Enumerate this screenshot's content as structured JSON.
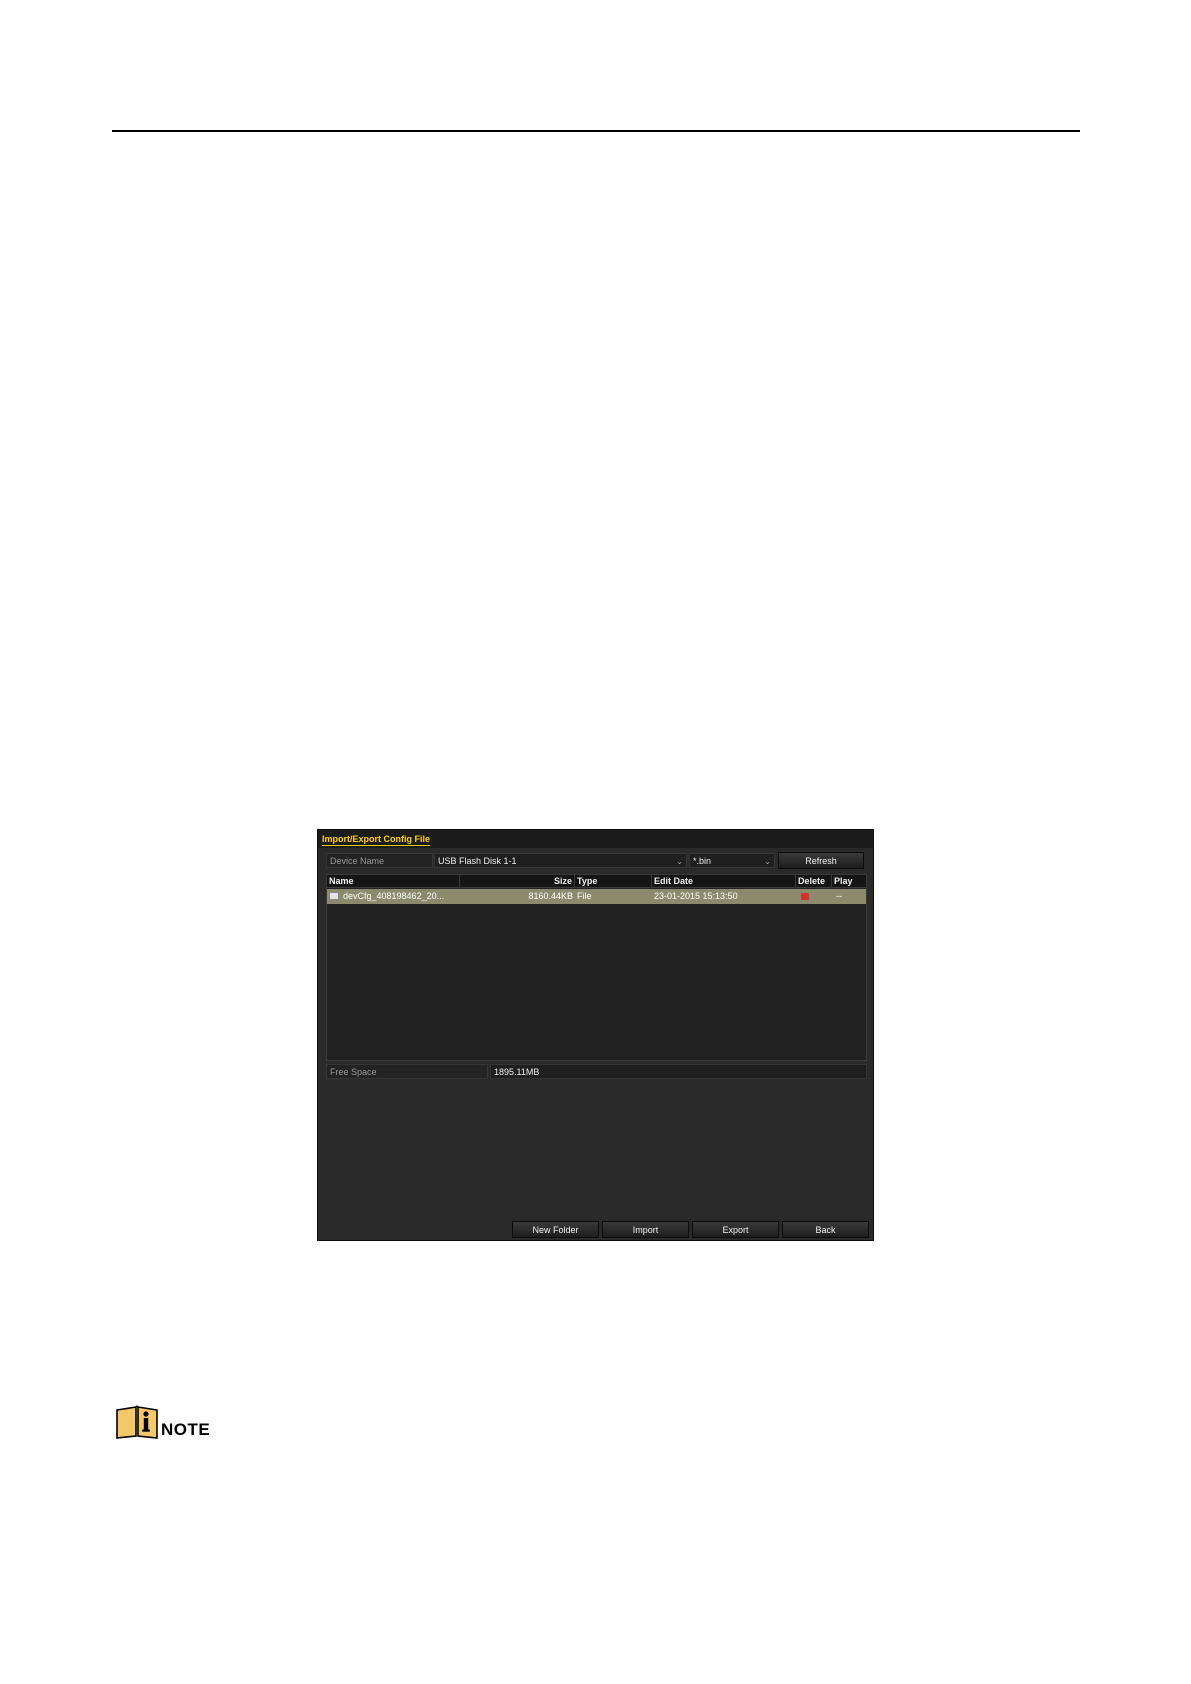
{
  "dialog": {
    "title": "Import/Export Config File",
    "device_name_label": "Device Name",
    "device_name_value": "USB Flash Disk 1-1",
    "filter_value": "*.bin",
    "refresh_label": "Refresh",
    "columns": {
      "name": "Name",
      "size": "Size",
      "type": "Type",
      "edit_date": "Edit Date",
      "delete": "Delete",
      "play": "Play"
    },
    "files": [
      {
        "name": "devCfg_408198462_20...",
        "size": "8160.44KB",
        "type": "File",
        "edit_date": "23-01-2015 15:13:50",
        "play": "--"
      }
    ],
    "free_space_label": "Free Space",
    "free_space_value": "1895.11MB",
    "buttons": {
      "new_folder": "New Folder",
      "import": "Import",
      "export": "Export",
      "back": "Back"
    },
    "colors": {
      "title_accent": "#ffd200",
      "selected_row": "#8b8a6d",
      "delete_icon": "#d6322b"
    }
  },
  "note": {
    "label": "NOTE",
    "icon": "info-book-icon"
  }
}
